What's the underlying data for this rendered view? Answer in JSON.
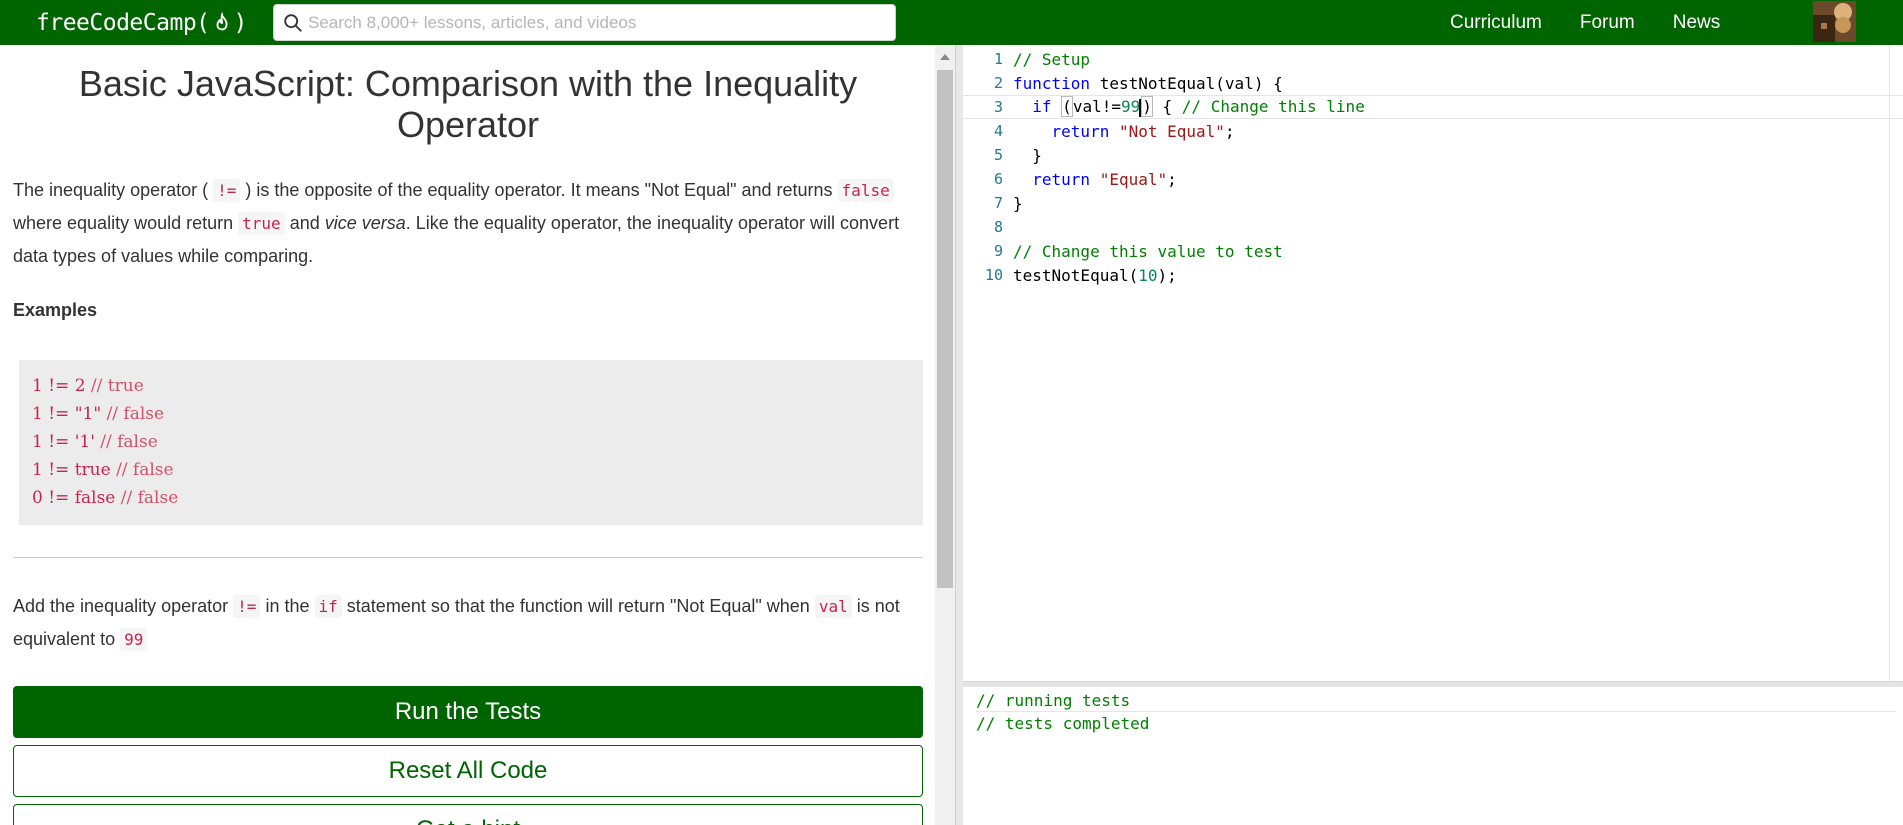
{
  "nav": {
    "logo_text_left": "freeCodeCamp(",
    "logo_text_right": ")",
    "search_placeholder": "Search 8,000+ lessons, articles, and videos",
    "links": [
      "Curriculum",
      "Forum",
      "News"
    ]
  },
  "challenge": {
    "title": "Basic JavaScript: Comparison with the Inequality Operator",
    "p1": {
      "t1": "The inequality operator (",
      "c1": "!=",
      "t2": ") is the opposite of the equality operator. It means \"Not Equal\" and returns",
      "c2": "false",
      "t3": "where equality would return",
      "c3": "true",
      "t4": "and",
      "t5": "vice versa",
      "t6": ". Like the equality operator, the inequality operator will convert data types of values while comparing."
    },
    "examples_heading": "Examples",
    "examples": [
      {
        "code": "1 != 2 ",
        "comment": "// true"
      },
      {
        "code": "1 != \"1\" ",
        "comment": "// false"
      },
      {
        "code": "1 != '1' ",
        "comment": "// false"
      },
      {
        "code": "1 != true ",
        "comment": "// false"
      },
      {
        "code": "0 != false ",
        "comment": "// false"
      }
    ],
    "instructions": {
      "t1": "Add the inequality operator",
      "c1": "!=",
      "t2": "in the",
      "c2": "if",
      "t3": "statement so that the function will return \"Not Equal\" when",
      "c3": "val",
      "t4": "is not equivalent to",
      "c4": "99"
    },
    "buttons": {
      "run": "Run the Tests",
      "reset": "Reset All Code",
      "hint": "Get a hint"
    }
  },
  "editor": {
    "lines": [
      {
        "num": "1"
      },
      {
        "num": "2"
      },
      {
        "num": "3"
      },
      {
        "num": "4"
      },
      {
        "num": "5"
      },
      {
        "num": "6"
      },
      {
        "num": "7"
      },
      {
        "num": "8"
      },
      {
        "num": "9"
      },
      {
        "num": "10"
      }
    ],
    "tokens": {
      "l1_comment": "// Setup",
      "l2_kw": "function",
      "l2_rest": " testNotEqual(val) {",
      "l3_kw": "if",
      "l3_paren_open": "(",
      "l3_expr": "val!=",
      "l3_num": "99",
      "l3_paren_close": ")",
      "l3_brace": " { ",
      "l3_comment": "// Change this line",
      "l4_kw": "return",
      "l4_str": "\"Not Equal\"",
      "l4_semi": ";",
      "l5": "}",
      "l6_kw": "return",
      "l6_str": "\"Equal\"",
      "l6_semi": ";",
      "l7": "}",
      "l9_comment": "// Change this value to test",
      "l10_call": "testNotEqual(",
      "l10_num": "10",
      "l10_end": ");"
    }
  },
  "console": {
    "lines": [
      "// running tests",
      "// tests completed"
    ]
  },
  "colors": {
    "brand_green": "#006400",
    "inline_code_red": "#c7254e",
    "editor_comment": "#008000",
    "editor_keyword": "#0000ff",
    "editor_string": "#a31515",
    "editor_number": "#098658"
  }
}
